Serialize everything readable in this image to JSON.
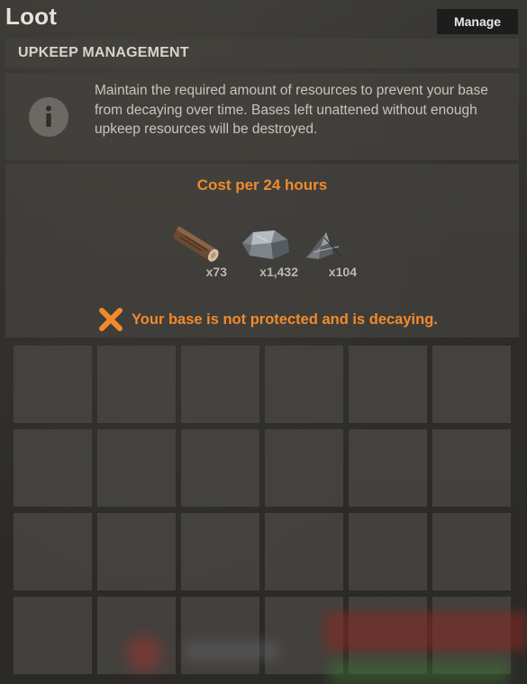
{
  "window": {
    "title": "Loot",
    "manage_label": "Manage"
  },
  "upkeep": {
    "header": "UPKEEP MANAGEMENT",
    "info_text": "Maintain the required amount of resources to prevent your base from decaying over time. Bases left unattened without enough upkeep resources will be destroyed.",
    "cost_title": "Cost per 24 hours",
    "resources": [
      {
        "icon": "wood-log-icon",
        "amount": "x73"
      },
      {
        "icon": "stone-icon",
        "amount": "x1,432"
      },
      {
        "icon": "metal-fragments-icon",
        "amount": "x104"
      }
    ],
    "status_icon": "x-mark-icon",
    "status_text": "Your base is not protected and is decaying."
  },
  "colors": {
    "accent_orange": "#f28a2c",
    "panel": "#44423e",
    "background": "#2b2a27"
  },
  "inventory": {
    "columns": 6,
    "rows": 4,
    "slots_filled": 0
  }
}
